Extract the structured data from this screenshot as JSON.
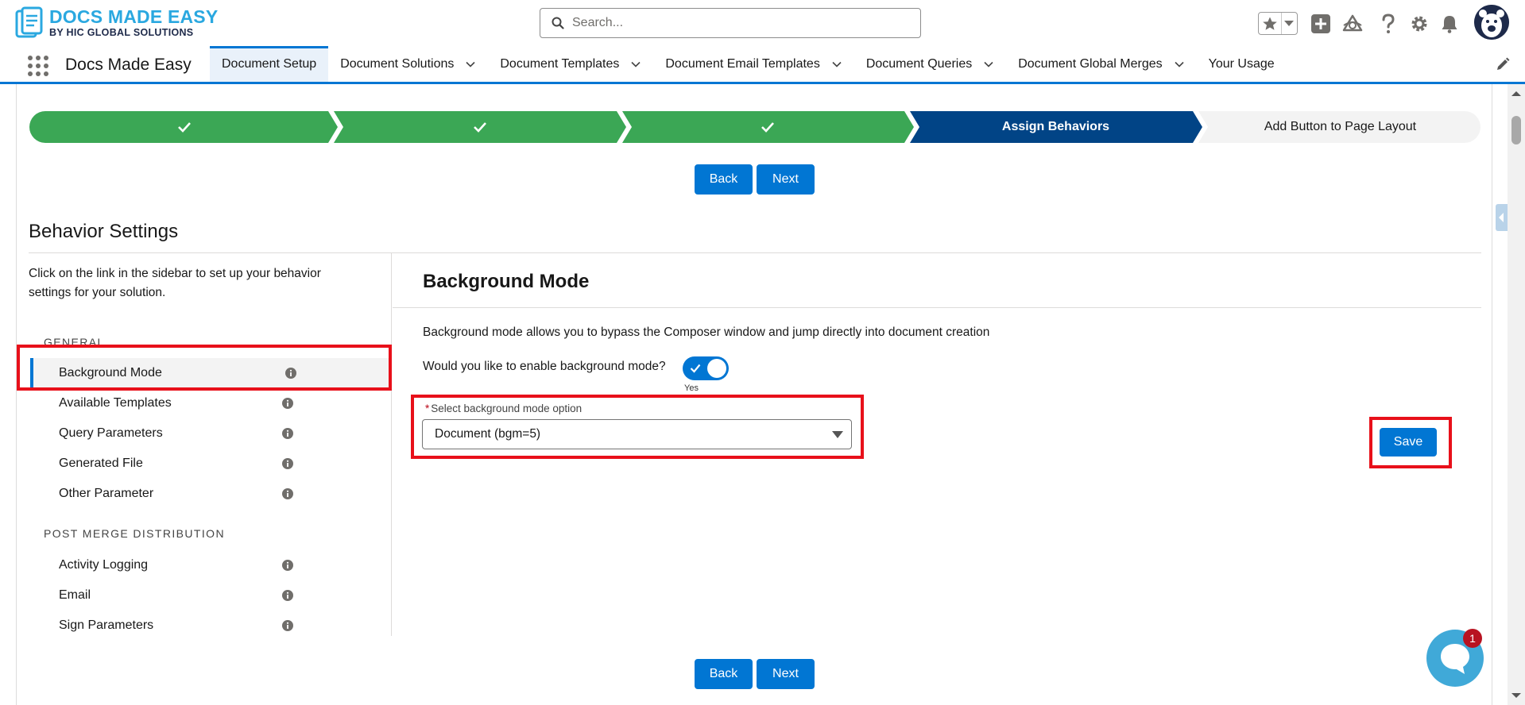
{
  "brand": {
    "line1": "DOCS MADE EASY",
    "line2": "BY HIC GLOBAL SOLUTIONS",
    "accent": "#2aa8e0",
    "navy": "#1e2a4a"
  },
  "search": {
    "placeholder": "Search..."
  },
  "header_icons": [
    "star-icon",
    "chevron-down-icon",
    "add-icon",
    "setup-assistant-icon",
    "help-icon",
    "gear-icon",
    "bell-icon",
    "avatar"
  ],
  "app": {
    "name": "Docs Made Easy"
  },
  "nav": {
    "tabs": [
      {
        "label": "Document Setup",
        "active": true,
        "menu": false
      },
      {
        "label": "Document Solutions",
        "active": false,
        "menu": true
      },
      {
        "label": "Document Templates",
        "active": false,
        "menu": true
      },
      {
        "label": "Document Email Templates",
        "active": false,
        "menu": true
      },
      {
        "label": "Document Queries",
        "active": false,
        "menu": true
      },
      {
        "label": "Document Global Merges",
        "active": false,
        "menu": true
      },
      {
        "label": "Your Usage",
        "active": false,
        "menu": false
      }
    ]
  },
  "path": {
    "steps": [
      {
        "label": "",
        "status": "complete"
      },
      {
        "label": "",
        "status": "complete"
      },
      {
        "label": "",
        "status": "complete"
      },
      {
        "label": "Assign Behaviors",
        "status": "current"
      },
      {
        "label": "Add Button to Page Layout",
        "status": "incomplete"
      }
    ]
  },
  "buttons": {
    "back": "Back",
    "next": "Next",
    "save": "Save"
  },
  "behavior": {
    "title": "Behavior Settings",
    "intro": "Click on the link in the sidebar to set up your behavior settings for your solution.",
    "general_heading": "GENERAL",
    "general_items": [
      "Background Mode",
      "Available Templates",
      "Query Parameters",
      "Generated File",
      "Other Parameter"
    ],
    "post_heading": "POST MERGE DISTRIBUTION",
    "post_items": [
      "Activity Logging",
      "Email",
      "Sign Parameters"
    ]
  },
  "background_mode": {
    "title": "Background Mode",
    "description": "Background mode allows you to bypass the Composer window and jump directly into document creation",
    "toggle_label": "Would you like to enable background mode?",
    "toggle_state": "Yes",
    "select_required": "*",
    "select_label": "Select background mode option",
    "select_value": "Document (bgm=5)"
  },
  "chat": {
    "badge": "1"
  },
  "colors": {
    "brand_blue": "#0176d3",
    "complete": "#3ba755",
    "current": "#014486",
    "highlight": "#e8101a"
  }
}
